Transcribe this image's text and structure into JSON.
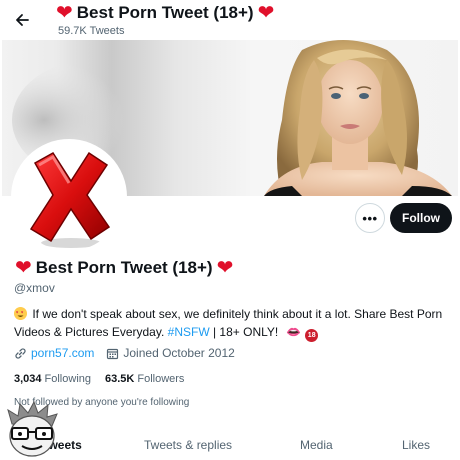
{
  "header": {
    "title": "Best Porn Tweet (18+)",
    "tweet_count": "59.7K Tweets",
    "back_icon": "arrow-left-icon"
  },
  "profile": {
    "name": "Best Porn Tweet (18+)",
    "handle": "@xmov",
    "bio_part1": " If we don't speak about sex, we definitely think about it a lot. Share Best Porn Videos & Pictures Everyday. ",
    "bio_hashtag": "#NSFW",
    "bio_part2": " | 18+ ONLY!",
    "bio_badge": "18",
    "website": "porn57.com",
    "joined": "Joined October 2012",
    "following_count": "3,034",
    "following_label": "Following",
    "followers_count": "63.5K",
    "followers_label": "Followers",
    "not_followed_text": "Not followed by anyone you're following"
  },
  "actions": {
    "more_label": "•••",
    "follow_label": "Follow"
  },
  "tabs": [
    {
      "label": "Tweets",
      "active": true
    },
    {
      "label": "Tweets & replies",
      "active": false
    },
    {
      "label": "Media",
      "active": false
    },
    {
      "label": "Likes",
      "active": false
    }
  ],
  "colors": {
    "accent": "#1d9bf0",
    "heart": "#e0102b",
    "follow_bg": "#0f1419"
  }
}
